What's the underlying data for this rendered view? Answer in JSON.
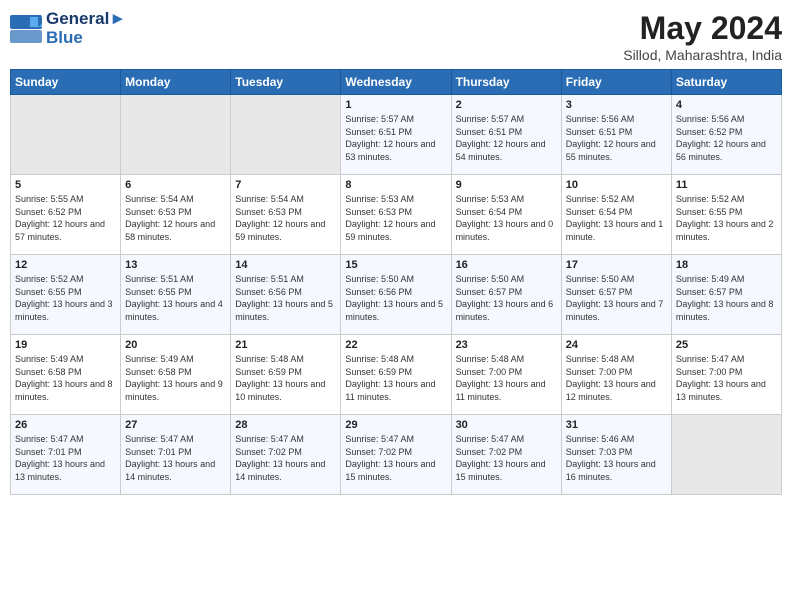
{
  "logo": {
    "line1": "General",
    "line2": "Blue"
  },
  "title": "May 2024",
  "subtitle": "Sillod, Maharashtra, India",
  "days_of_week": [
    "Sunday",
    "Monday",
    "Tuesday",
    "Wednesday",
    "Thursday",
    "Friday",
    "Saturday"
  ],
  "weeks": [
    [
      {
        "day": "",
        "info": ""
      },
      {
        "day": "",
        "info": ""
      },
      {
        "day": "",
        "info": ""
      },
      {
        "day": "1",
        "info": "Sunrise: 5:57 AM\nSunset: 6:51 PM\nDaylight: 12 hours\nand 53 minutes."
      },
      {
        "day": "2",
        "info": "Sunrise: 5:57 AM\nSunset: 6:51 PM\nDaylight: 12 hours\nand 54 minutes."
      },
      {
        "day": "3",
        "info": "Sunrise: 5:56 AM\nSunset: 6:51 PM\nDaylight: 12 hours\nand 55 minutes."
      },
      {
        "day": "4",
        "info": "Sunrise: 5:56 AM\nSunset: 6:52 PM\nDaylight: 12 hours\nand 56 minutes."
      }
    ],
    [
      {
        "day": "5",
        "info": "Sunrise: 5:55 AM\nSunset: 6:52 PM\nDaylight: 12 hours\nand 57 minutes."
      },
      {
        "day": "6",
        "info": "Sunrise: 5:54 AM\nSunset: 6:53 PM\nDaylight: 12 hours\nand 58 minutes."
      },
      {
        "day": "7",
        "info": "Sunrise: 5:54 AM\nSunset: 6:53 PM\nDaylight: 12 hours\nand 59 minutes."
      },
      {
        "day": "8",
        "info": "Sunrise: 5:53 AM\nSunset: 6:53 PM\nDaylight: 12 hours\nand 59 minutes."
      },
      {
        "day": "9",
        "info": "Sunrise: 5:53 AM\nSunset: 6:54 PM\nDaylight: 13 hours\nand 0 minutes."
      },
      {
        "day": "10",
        "info": "Sunrise: 5:52 AM\nSunset: 6:54 PM\nDaylight: 13 hours\nand 1 minute."
      },
      {
        "day": "11",
        "info": "Sunrise: 5:52 AM\nSunset: 6:55 PM\nDaylight: 13 hours\nand 2 minutes."
      }
    ],
    [
      {
        "day": "12",
        "info": "Sunrise: 5:52 AM\nSunset: 6:55 PM\nDaylight: 13 hours\nand 3 minutes."
      },
      {
        "day": "13",
        "info": "Sunrise: 5:51 AM\nSunset: 6:55 PM\nDaylight: 13 hours\nand 4 minutes."
      },
      {
        "day": "14",
        "info": "Sunrise: 5:51 AM\nSunset: 6:56 PM\nDaylight: 13 hours\nand 5 minutes."
      },
      {
        "day": "15",
        "info": "Sunrise: 5:50 AM\nSunset: 6:56 PM\nDaylight: 13 hours\nand 5 minutes."
      },
      {
        "day": "16",
        "info": "Sunrise: 5:50 AM\nSunset: 6:57 PM\nDaylight: 13 hours\nand 6 minutes."
      },
      {
        "day": "17",
        "info": "Sunrise: 5:50 AM\nSunset: 6:57 PM\nDaylight: 13 hours\nand 7 minutes."
      },
      {
        "day": "18",
        "info": "Sunrise: 5:49 AM\nSunset: 6:57 PM\nDaylight: 13 hours\nand 8 minutes."
      }
    ],
    [
      {
        "day": "19",
        "info": "Sunrise: 5:49 AM\nSunset: 6:58 PM\nDaylight: 13 hours\nand 8 minutes."
      },
      {
        "day": "20",
        "info": "Sunrise: 5:49 AM\nSunset: 6:58 PM\nDaylight: 13 hours\nand 9 minutes."
      },
      {
        "day": "21",
        "info": "Sunrise: 5:48 AM\nSunset: 6:59 PM\nDaylight: 13 hours\nand 10 minutes."
      },
      {
        "day": "22",
        "info": "Sunrise: 5:48 AM\nSunset: 6:59 PM\nDaylight: 13 hours\nand 11 minutes."
      },
      {
        "day": "23",
        "info": "Sunrise: 5:48 AM\nSunset: 7:00 PM\nDaylight: 13 hours\nand 11 minutes."
      },
      {
        "day": "24",
        "info": "Sunrise: 5:48 AM\nSunset: 7:00 PM\nDaylight: 13 hours\nand 12 minutes."
      },
      {
        "day": "25",
        "info": "Sunrise: 5:47 AM\nSunset: 7:00 PM\nDaylight: 13 hours\nand 13 minutes."
      }
    ],
    [
      {
        "day": "26",
        "info": "Sunrise: 5:47 AM\nSunset: 7:01 PM\nDaylight: 13 hours\nand 13 minutes."
      },
      {
        "day": "27",
        "info": "Sunrise: 5:47 AM\nSunset: 7:01 PM\nDaylight: 13 hours\nand 14 minutes."
      },
      {
        "day": "28",
        "info": "Sunrise: 5:47 AM\nSunset: 7:02 PM\nDaylight: 13 hours\nand 14 minutes."
      },
      {
        "day": "29",
        "info": "Sunrise: 5:47 AM\nSunset: 7:02 PM\nDaylight: 13 hours\nand 15 minutes."
      },
      {
        "day": "30",
        "info": "Sunrise: 5:47 AM\nSunset: 7:02 PM\nDaylight: 13 hours\nand 15 minutes."
      },
      {
        "day": "31",
        "info": "Sunrise: 5:46 AM\nSunset: 7:03 PM\nDaylight: 13 hours\nand 16 minutes."
      },
      {
        "day": "",
        "info": ""
      }
    ]
  ]
}
